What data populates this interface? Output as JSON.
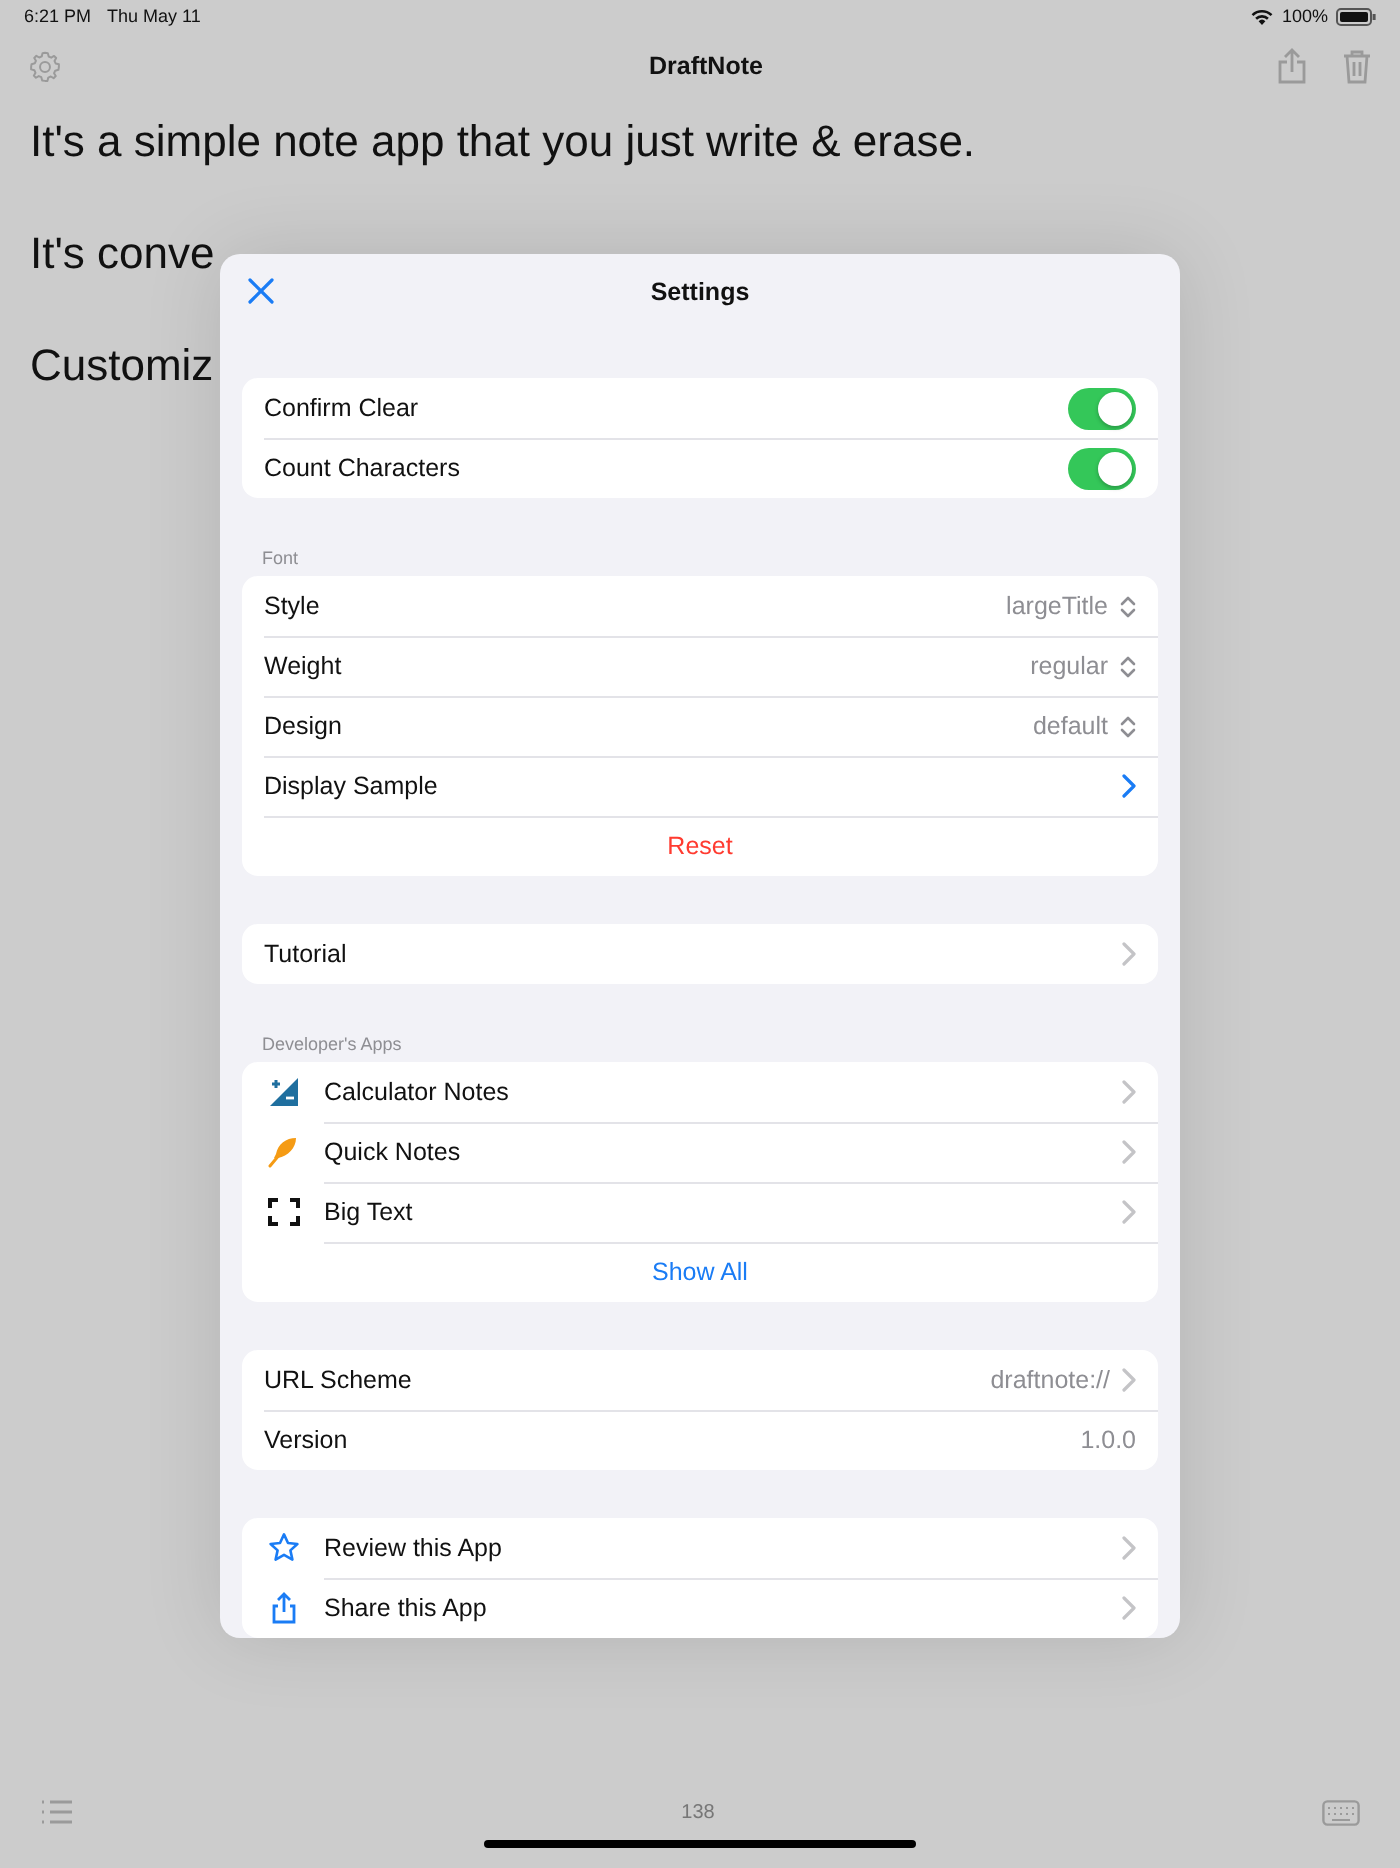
{
  "status_bar": {
    "time": "6:21 PM",
    "date": "Thu May 11",
    "battery": "100%"
  },
  "nav_bar": {
    "title": "DraftNote"
  },
  "note": {
    "paragraphs": [
      "It's a simple note app that you just write & erase.",
      "It's conve",
      "Customiz"
    ]
  },
  "settings": {
    "title": "Settings",
    "sections": [
      {
        "rows": [
          {
            "kind": "toggle",
            "label": "Confirm Clear",
            "on": true
          },
          {
            "kind": "toggle",
            "label": "Count Characters",
            "on": true
          }
        ]
      },
      {
        "header": "Font",
        "rows": [
          {
            "kind": "picker",
            "label": "Style",
            "value": "largeTitle"
          },
          {
            "kind": "picker",
            "label": "Weight",
            "value": "regular"
          },
          {
            "kind": "picker",
            "label": "Design",
            "value": "default"
          },
          {
            "kind": "accent_link",
            "label": "Display Sample"
          },
          {
            "kind": "action",
            "label": "Reset"
          }
        ]
      },
      {
        "rows": [
          {
            "kind": "link",
            "label": "Tutorial"
          }
        ]
      },
      {
        "header": "Developer's Apps",
        "rows": [
          {
            "kind": "app",
            "label": "Calculator Notes"
          },
          {
            "kind": "app",
            "label": "Quick Notes"
          },
          {
            "kind": "app",
            "label": "Big Text"
          },
          {
            "kind": "more",
            "label": "Show All"
          }
        ]
      },
      {
        "rows": [
          {
            "kind": "value_link",
            "label": "URL Scheme",
            "value": "draftnote://"
          },
          {
            "kind": "value",
            "label": "Version",
            "value": "1.0.0"
          }
        ]
      },
      {
        "rows": [
          {
            "kind": "app",
            "label": "Review this App"
          },
          {
            "kind": "app",
            "label": "Share this App"
          }
        ]
      }
    ]
  },
  "bottom_bar": {
    "character_count": "138"
  }
}
